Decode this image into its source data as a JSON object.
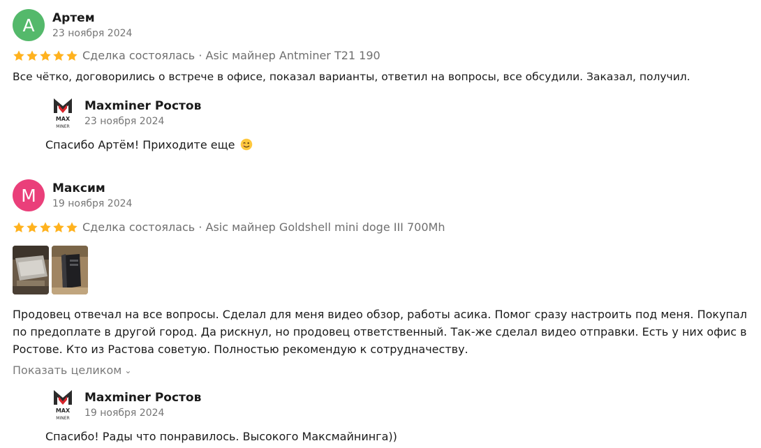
{
  "reviews": [
    {
      "avatar_letter": "А",
      "avatar_color": "#54b96b",
      "author": "Артем",
      "date": "23 ноября 2024",
      "rating": 5,
      "deal_info": "Сделка состоялась · Asic майнер Antminer T21 190",
      "text": "Все чётко, договорились о встрече в офисе, показал варианты, ответил на вопросы, все обсудили. Заказал, получил.",
      "reply": {
        "author": "Maxminer Ростов",
        "logo_icon": "maxminer-logo",
        "date": "23 ноября 2024",
        "text": "Спасибо Артём! Приходите еще",
        "emoji": "winking-face"
      }
    },
    {
      "avatar_letter": "М",
      "avatar_color": "#ea3f7a",
      "author": "Максим",
      "date": "19 ноября 2024",
      "rating": 5,
      "deal_info": "Сделка состоялась · Asic майнер Goldshell mini doge III 700Mh",
      "photos": [
        "review-photo-1",
        "review-photo-2"
      ],
      "text_lines": [
        "Продовец отвечал на все вопросы. Сделал для меня видео обзор, работы асика. Помог сразу настроить под меня. Покупал",
        "по предоплате в другой город. Да рискнул, но продовец ответственный. Так-же сделал видео отправки. Есть у них офис в",
        "Ростове. Кто из Растова советую. Полностью рекомендую к сотрудначеству."
      ],
      "expand_label": "Показать целиком",
      "reply": {
        "author": "Maxminer Ростов",
        "logo_icon": "maxminer-logo",
        "date": "19 ноября 2024",
        "text": "Спасибо! Рады что понравилось. Высокого Максмайнинга))"
      }
    }
  ],
  "colors": {
    "star": "#ffb21e",
    "logo_red": "#d9252b",
    "logo_dark": "#2b2b2b"
  }
}
